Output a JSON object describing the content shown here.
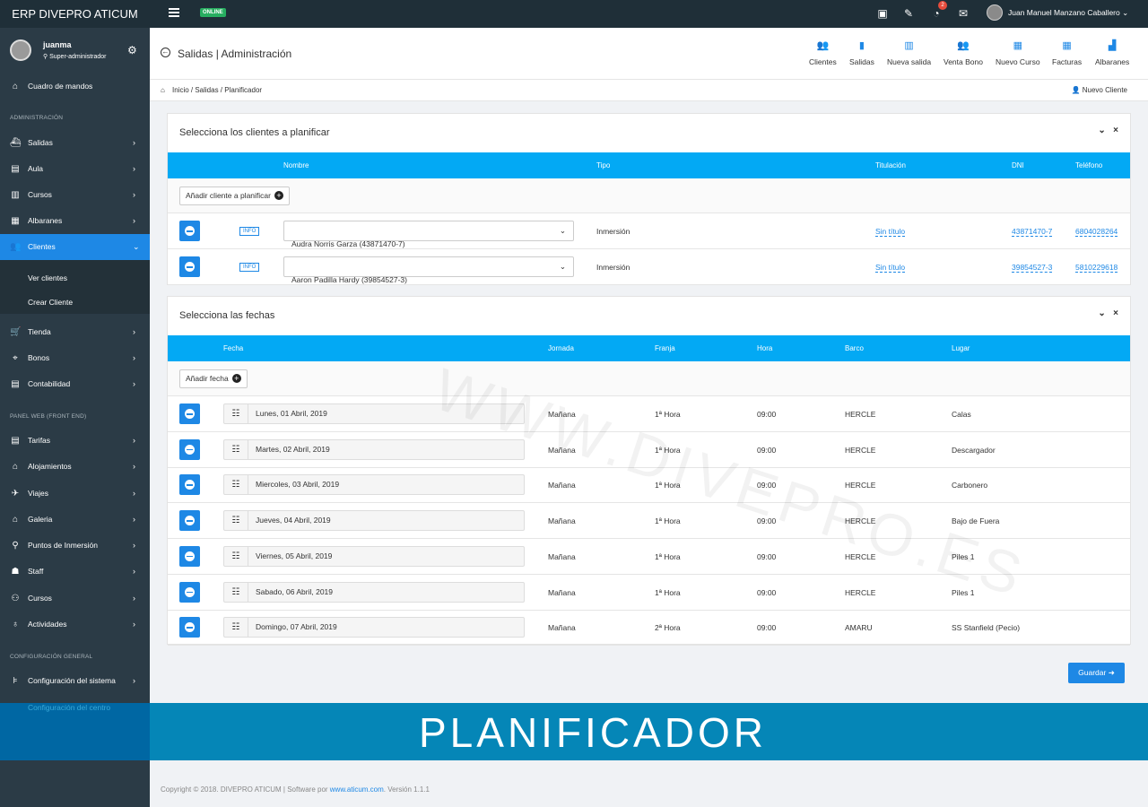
{
  "topbar": {
    "brand": "ERP DIVEPRO ATICUM",
    "status": "ONLINE",
    "notification_count": "2",
    "user_name": "Juan Manuel Manzano Caballero"
  },
  "profile": {
    "username": "juanma",
    "role": "Super-administrador"
  },
  "sidebar": {
    "dashboard": "Cuadro de mandos",
    "section_admin": "ADMINISTRACIÓN",
    "items_admin": [
      "Salidas",
      "Aula",
      "Cursos",
      "Albaranes",
      "Clientes"
    ],
    "clientes_sub": [
      "Ver clientes",
      "Crear Cliente"
    ],
    "items_admin2": [
      "Tienda",
      "Bonos",
      "Contabilidad"
    ],
    "section_web": "PANEL WEB (FRONT END)",
    "items_web": [
      "Tarifas",
      "Alojamientos",
      "Viajes",
      "Galeria",
      "Puntos de Inmersión",
      "Staff",
      "Cursos",
      "Actividades"
    ],
    "section_config": "CONFIGURACIÓN GENERAL",
    "items_config": [
      "Configuración del sistema",
      "Configuración del centro"
    ]
  },
  "header": {
    "title": "Salidas | Administración",
    "actions": [
      "Clientes",
      "Salidas",
      "Nueva salida",
      "Venta Bono",
      "Nuevo Curso",
      "Facturas",
      "Albaranes"
    ]
  },
  "breadcrumb": {
    "items": "Inicio  /  Salidas  /  Planificador",
    "new_client": "Nuevo Cliente"
  },
  "clients_panel": {
    "title": "Selecciona los clientes a planificar",
    "columns": [
      "Nombre",
      "Tipo",
      "Titulación",
      "DNI",
      "Teléfono"
    ],
    "add_label": "Añadir cliente a planificar",
    "info_label": "INFO",
    "rows": [
      {
        "name": "Audra Norris Garza (43871470-7)",
        "tipo": "Inmersión",
        "titulacion": "Sin título",
        "dni": "43871470-7",
        "telefono": "6804028264"
      },
      {
        "name": "Aaron Padilla Hardy (39854527-3)",
        "tipo": "Inmersión",
        "titulacion": "Sin título",
        "dni": "39854527-3",
        "telefono": "5810229618"
      }
    ]
  },
  "dates_panel": {
    "title": "Selecciona las fechas",
    "columns": [
      "Fecha",
      "Jornada",
      "Franja",
      "Hora",
      "Barco",
      "Lugar"
    ],
    "add_label": "Añadir fecha",
    "rows": [
      {
        "fecha": "Lunes, 01 Abril, 2019",
        "jornada": "Mañana",
        "franja": "1ª Hora",
        "hora": "09:00",
        "barco": "HERCLE",
        "lugar": "Calas"
      },
      {
        "fecha": "Martes, 02 Abril, 2019",
        "jornada": "Mañana",
        "franja": "1ª Hora",
        "hora": "09:00",
        "barco": "HERCLE",
        "lugar": "Descargador"
      },
      {
        "fecha": "Miercoles, 03 Abril, 2019",
        "jornada": "Mañana",
        "franja": "1ª Hora",
        "hora": "09:00",
        "barco": "HERCLE",
        "lugar": "Carbonero"
      },
      {
        "fecha": "Jueves, 04 Abril, 2019",
        "jornada": "Mañana",
        "franja": "1ª Hora",
        "hora": "09:00",
        "barco": "HERCLE",
        "lugar": "Bajo de Fuera"
      },
      {
        "fecha": "Viernes, 05 Abril, 2019",
        "jornada": "Mañana",
        "franja": "1ª Hora",
        "hora": "09:00",
        "barco": "HERCLE",
        "lugar": "Piles 1"
      },
      {
        "fecha": "Sabado, 06 Abril, 2019",
        "jornada": "Mañana",
        "franja": "1ª Hora",
        "hora": "09:00",
        "barco": "HERCLE",
        "lugar": "Piles 1"
      },
      {
        "fecha": "Domingo, 07 Abril, 2019",
        "jornada": "Mañana",
        "franja": "2ª Hora",
        "hora": "09:00",
        "barco": "AMARU",
        "lugar": "SS Stanfield (Pecio)"
      }
    ]
  },
  "save_label": "Guardar",
  "watermark": "WWW.DIVEPRO.ES",
  "banner": "PLANIFICADOR",
  "footer": {
    "text": "Copyright © 2018. DIVEPRO ATICUM | Software por ",
    "link": "www.aticum.com",
    "version": ". Versión 1.1.1"
  },
  "colors": {
    "accent": "#1e88e5",
    "table_header": "#03a9f4",
    "sidebar": "#2b3b46",
    "topbar": "#1f2f38",
    "banner": "#0586b7",
    "online": "#27ae60"
  }
}
